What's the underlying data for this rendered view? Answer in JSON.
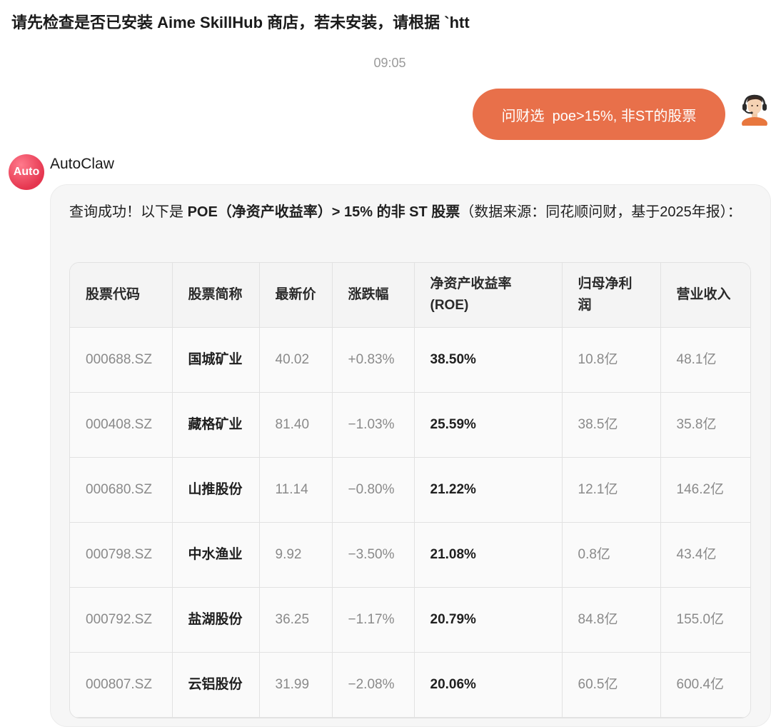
{
  "chat": {
    "title": "请先检查是否已安装 Aime SkillHub 商店，若未安装，请根据 `htt",
    "timestamp": "09:05"
  },
  "user_message": {
    "text": "问财选  poe>15%, 非ST的股票"
  },
  "bot": {
    "avatar_label": "Auto",
    "name": "AutoClaw",
    "intro": {
      "part1": "查询成功！以下是 ",
      "bold1": "POE（净资产收益率）> 15% 的非 ST 股票",
      "part2": "（数据来源：同花顺问财，基于2025年报）："
    }
  },
  "table": {
    "headers": [
      "股票代码",
      "股票简称",
      "最新价",
      "涨跌幅",
      "净资产收益率(ROE)",
      "归母净利润",
      "营业收入"
    ],
    "rows": [
      {
        "code": "000688.SZ",
        "name": "国城矿业",
        "price": "40.02",
        "change": "+0.83%",
        "roe": "38.50%",
        "net_profit": "10.8亿",
        "revenue": "48.1亿"
      },
      {
        "code": "000408.SZ",
        "name": "藏格矿业",
        "price": "81.40",
        "change": "−1.03%",
        "roe": "25.59%",
        "net_profit": "38.5亿",
        "revenue": "35.8亿"
      },
      {
        "code": "000680.SZ",
        "name": "山推股份",
        "price": "11.14",
        "change": "−0.80%",
        "roe": "21.22%",
        "net_profit": "12.1亿",
        "revenue": "146.2亿"
      },
      {
        "code": "000798.SZ",
        "name": "中水渔业",
        "price": "9.92",
        "change": "−3.50%",
        "roe": "21.08%",
        "net_profit": "0.8亿",
        "revenue": "43.4亿"
      },
      {
        "code": "000792.SZ",
        "name": "盐湖股份",
        "price": "36.25",
        "change": "−1.17%",
        "roe": "20.79%",
        "net_profit": "84.8亿",
        "revenue": "155.0亿"
      },
      {
        "code": "000807.SZ",
        "name": "云铝股份",
        "price": "31.99",
        "change": "−2.08%",
        "roe": "20.06%",
        "net_profit": "60.5亿",
        "revenue": "600.4亿"
      }
    ]
  },
  "colors": {
    "user_bubble": "#e8704a",
    "bot_avatar": "#e5364f",
    "card_bg": "#f6f6f6"
  }
}
